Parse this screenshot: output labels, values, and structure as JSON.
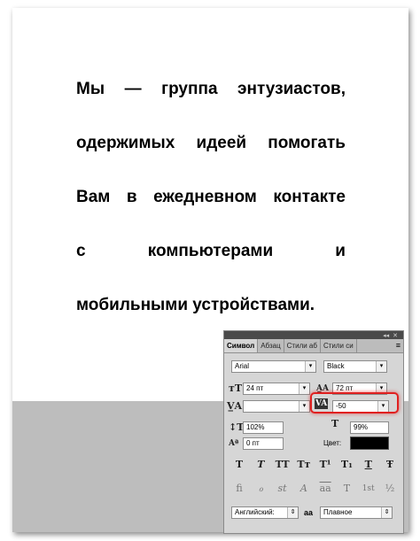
{
  "document": {
    "lines": [
      "Мы — группа энтузиастов,",
      "одержимых идеей помогать",
      "Вам в ежедневном контакте",
      "с компьютерами и",
      "мобильными устройствами."
    ]
  },
  "panel": {
    "tabs": [
      "Символ",
      "Абзац",
      "Стили аб",
      "Стили си"
    ],
    "font_family": "Arial",
    "font_style": "Black",
    "font_size": "24 пт",
    "leading": "72 пт",
    "kerning": "",
    "tracking": "-50",
    "vertical_scale": "102%",
    "horizontal_scale": "99%",
    "baseline_shift": "0 пт",
    "color_label": "Цвет:",
    "color_value": "#000000",
    "language": "Английский:",
    "antialias_symbol": "aa",
    "antialias": "Плавное",
    "style_buttons": [
      "T",
      "T",
      "TT",
      "Tт",
      "T¹",
      "T₁",
      "T",
      "Ŧ"
    ],
    "opentype_buttons": [
      "fi",
      "ℴ",
      "st",
      "A",
      "aa",
      "T",
      "1st",
      "½"
    ]
  }
}
